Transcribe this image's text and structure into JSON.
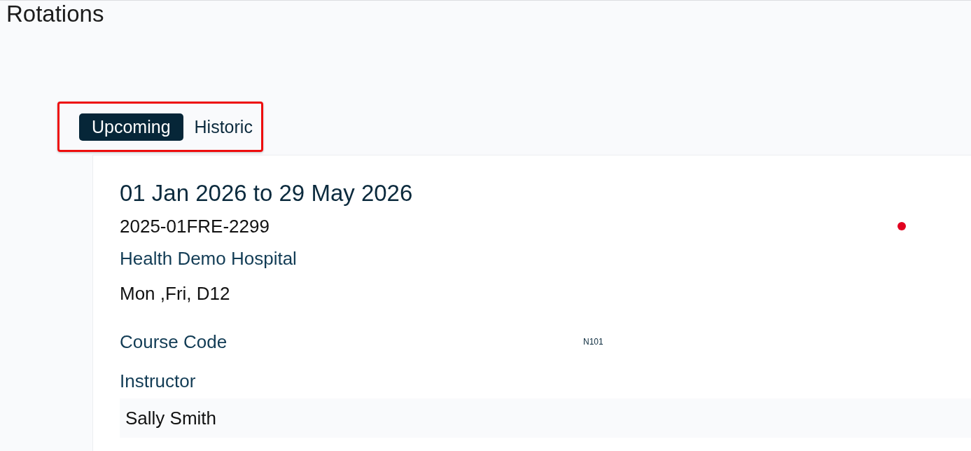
{
  "page_title": "Rotations",
  "tabs": [
    {
      "label": "Upcoming",
      "selected": true
    },
    {
      "label": "Historic",
      "selected": false
    }
  ],
  "rotation": {
    "dates": "01 Jan 2026 to 29 May 2026",
    "code": "2025-01FRE-2299",
    "site": "Health Demo Hospital",
    "schedule": "Mon ,Fri, D12",
    "fields": [
      {
        "label": "Course Code",
        "value": "N101"
      }
    ],
    "instructor_label": "Instructor",
    "instructors": [
      "Sally Smith"
    ]
  }
}
